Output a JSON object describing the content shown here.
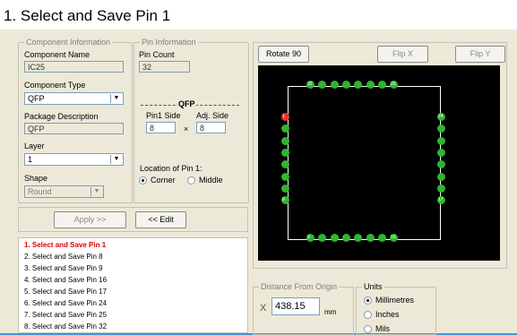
{
  "title": "1.  Select and Save Pin 1",
  "component_info": {
    "legend": "Component Information",
    "name_label": "Component Name",
    "name_value": "IC25",
    "type_label": "Component Type",
    "type_value": "QFP",
    "package_label": "Package Description",
    "package_value": "QFP",
    "layer_label": "Layer",
    "layer_value": "1",
    "shape_label": "Shape",
    "shape_value": "Round"
  },
  "pin_info": {
    "legend": "Pin Information",
    "count_label": "Pin Count",
    "count_value": "32",
    "qfp_label": "QFP",
    "pin1_side_label": "Pin1 Side",
    "pin1_side_value": "8",
    "adj_side_label": "Adj. Side",
    "adj_side_value": "8",
    "times": "×",
    "location_label": "Location of Pin 1:",
    "corner_label": "Corner",
    "middle_label": "Middle"
  },
  "buttons": {
    "apply": "Apply >>",
    "edit": "<< Edit",
    "rotate": "Rotate 90",
    "flip_x": "Flip X",
    "flip_y": "Flip Y"
  },
  "steps": [
    "1.  Select and Save Pin 1",
    "2.  Select and Save Pin 8",
    "3.  Select and Save Pin 9",
    "4.  Select and Save Pin 16",
    "5.  Select and Save Pin 17",
    "6.  Select and Save Pin 24",
    "7.  Select and Save Pin 25",
    "8.  Select and Save Pin 32"
  ],
  "distance": {
    "legend": "Distance From Origin",
    "axis": "X",
    "value": "438.15",
    "unit": "mm"
  },
  "units": {
    "legend": "Units",
    "millimetres": "Millimetres",
    "inches": "Inches",
    "mils": "Mils"
  },
  "pin_labels": {
    "top_left": "32",
    "top_right": "25",
    "left_top": "1",
    "left_bottom": "8",
    "right_top": "24",
    "right_bottom": "17",
    "bottom_left": "9",
    "bottom_right": "16"
  },
  "colors": {
    "pin": "#2fb52f",
    "pin1": "#e8332b",
    "canvas": "#000000",
    "active_step": "#dd0000"
  }
}
